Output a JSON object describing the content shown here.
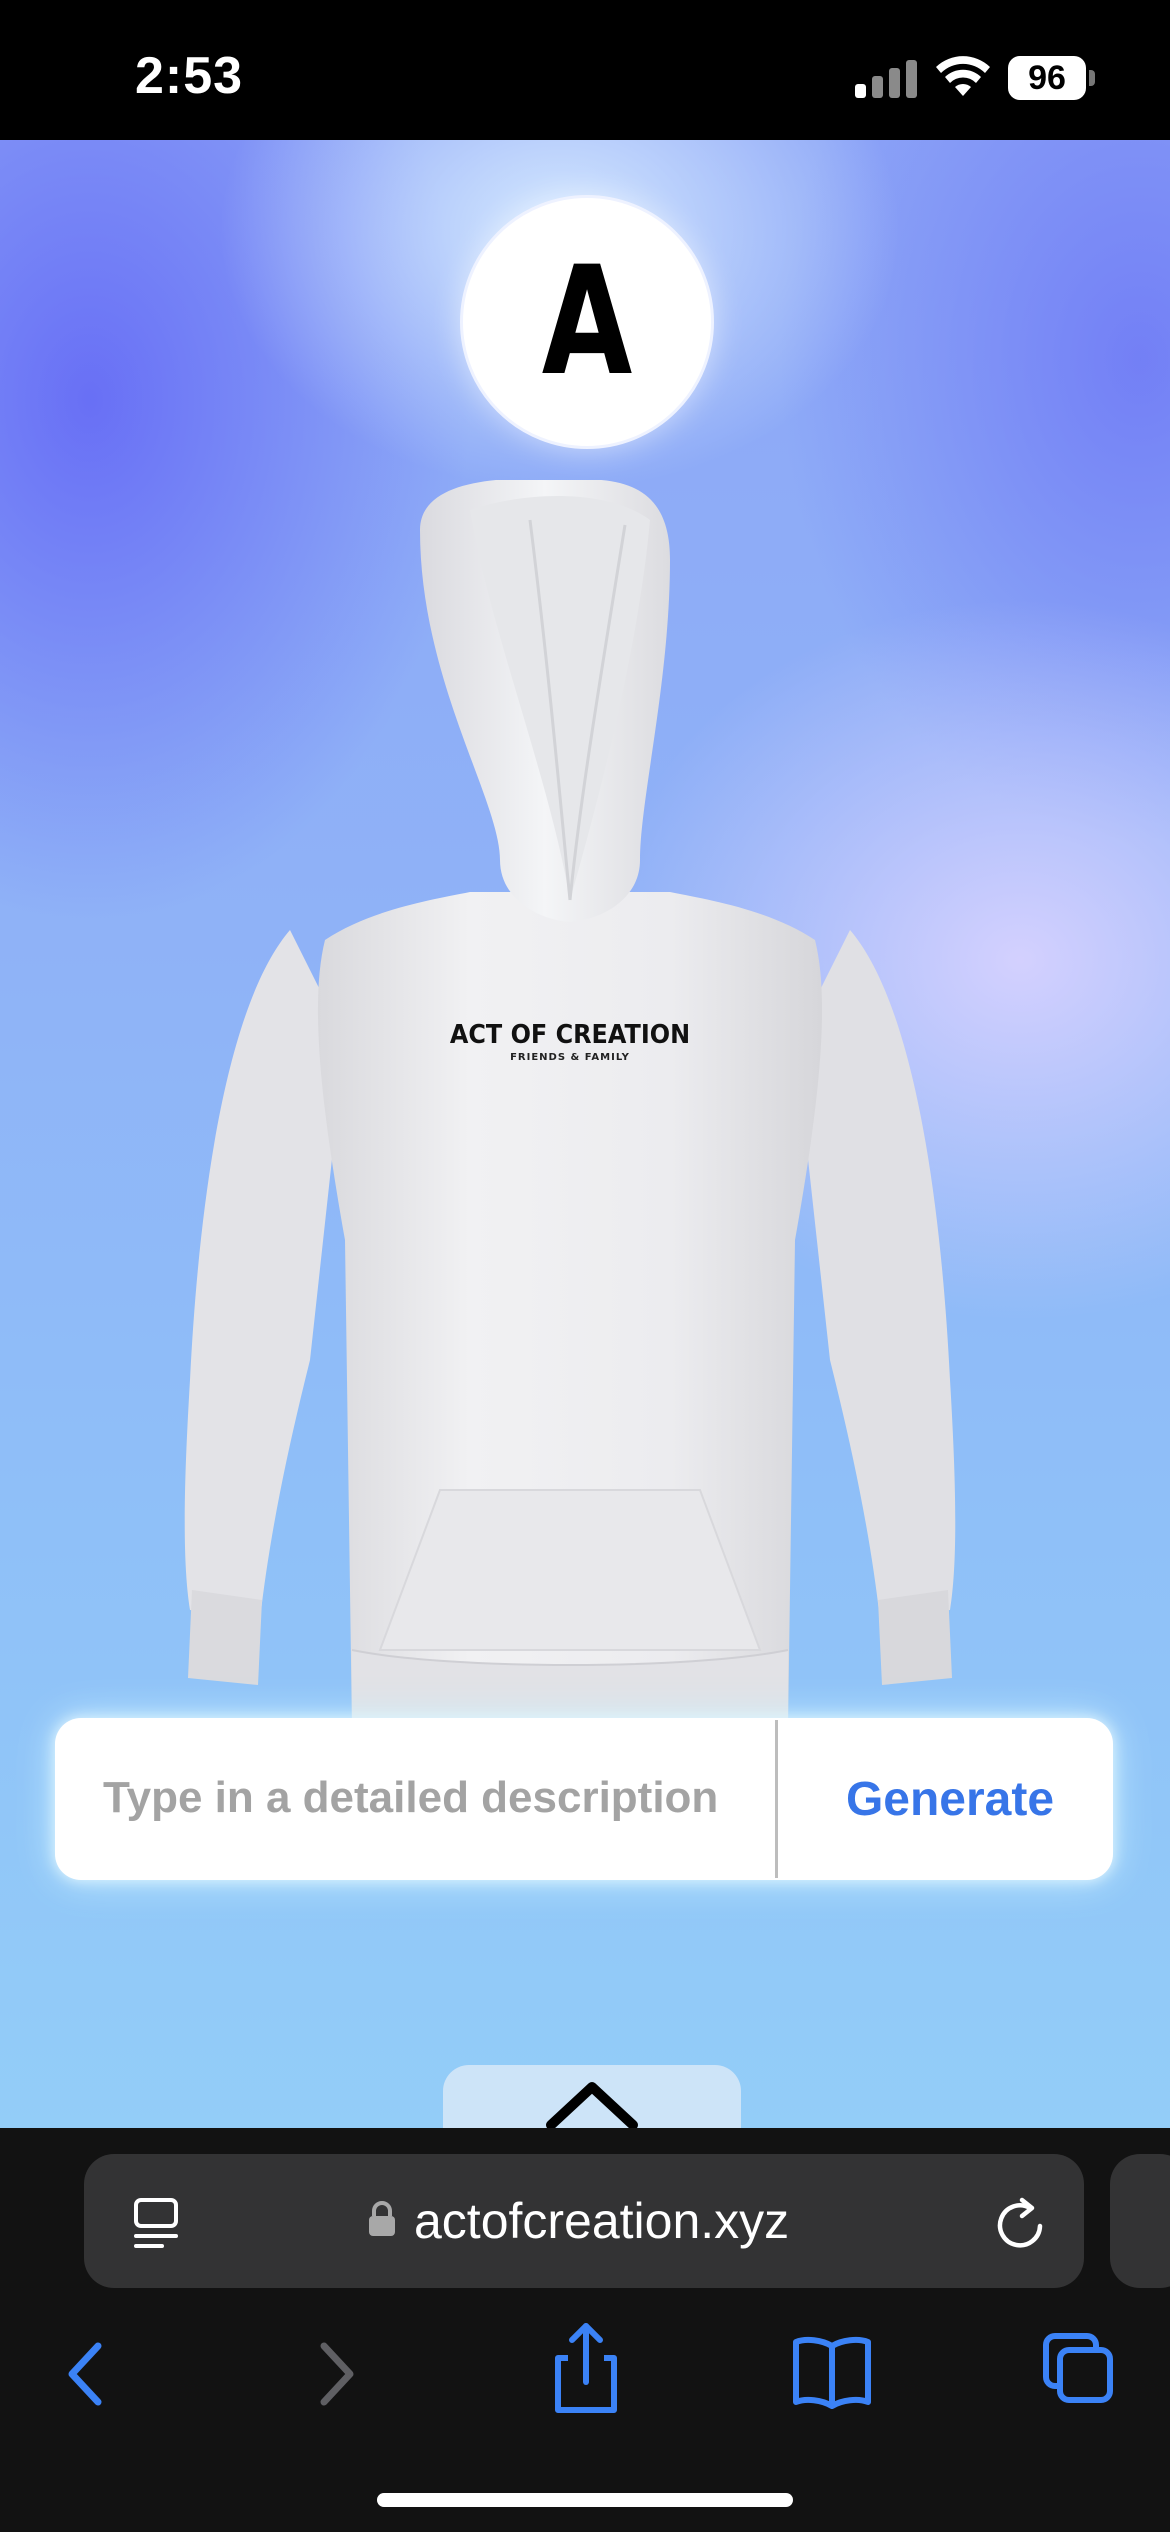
{
  "status_bar": {
    "time": "2:53",
    "battery_level": "96"
  },
  "page": {
    "logo_letter": "A",
    "product": {
      "type": "hoodie",
      "color": "#ececec",
      "print_title": "ACT OF CREATION",
      "print_subtitle": "FRIENDS & FAMILY"
    },
    "prompt": {
      "placeholder": "Type in a detailed description",
      "value": ""
    },
    "generate_label": "Generate",
    "drawer_toggle_icon": "chevron-up-icon"
  },
  "browser": {
    "url": "actofcreation.xyz",
    "toolbar_icons": [
      "back-icon",
      "forward-icon",
      "share-icon",
      "bookmarks-icon",
      "tabs-icon"
    ]
  },
  "colors": {
    "accent": "#3775e8",
    "browser_chrome": "#121212",
    "address_bar": "#333334"
  }
}
